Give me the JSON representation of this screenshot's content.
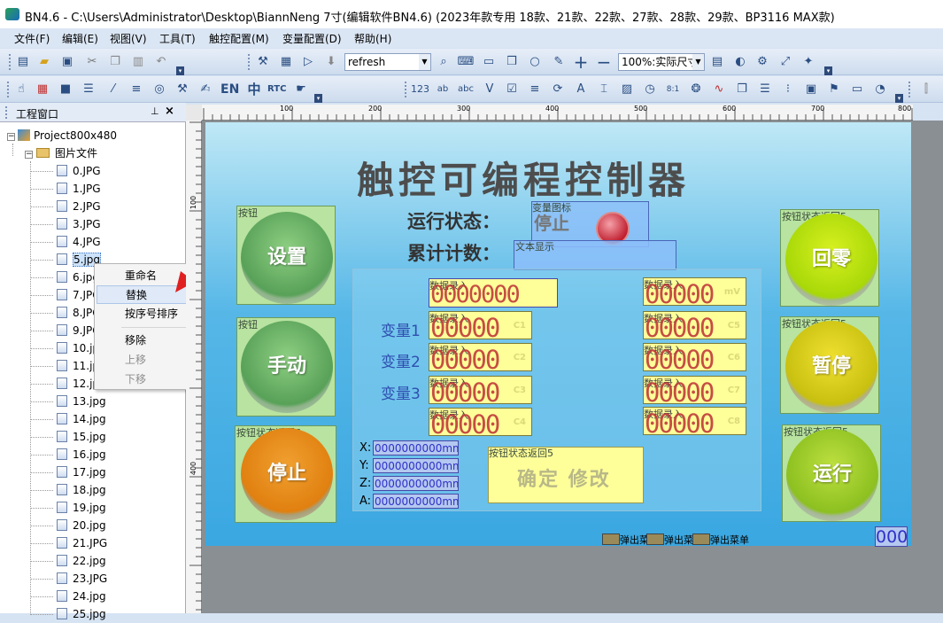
{
  "window": {
    "title": "BN4.6 - C:\\Users\\Administrator\\Desktop\\BiannNeng 7寸(编辑软件BN4.6) (2023年款专用 18款、21款、22款、27款、28款、29款、BP3116 MAX款)"
  },
  "menu": [
    "文件(F)",
    "编辑(E)",
    "视图(V)",
    "工具(T)",
    "触控配置(M)",
    "变量配置(D)",
    "帮助(H)"
  ],
  "toolbar": {
    "refresh_combo": "refresh",
    "zoom_combo": "100%:实际尺寸",
    "en_label": "EN",
    "zh_label": "中",
    "rtc_label": "RTC"
  },
  "panel": {
    "title": "工程窗口",
    "pin": "⊥",
    "close": "×"
  },
  "tree": {
    "project": "Project800x480",
    "folder": "图片文件",
    "files": [
      "0.JPG",
      "1.JPG",
      "2.JPG",
      "3.JPG",
      "4.JPG",
      "5.jpg",
      "6.jpg",
      "7.JPG",
      "8.JPG",
      "9.JPG",
      "10.jpg",
      "11.jpg",
      "12.jpg",
      "13.jpg",
      "14.jpg",
      "15.jpg",
      "16.jpg",
      "17.jpg",
      "18.jpg",
      "19.jpg",
      "20.jpg",
      "21.JPG",
      "22.jpg",
      "23.JPG",
      "24.jpg",
      "25.jpg"
    ]
  },
  "context_menu": {
    "items": [
      "重命名",
      "替换",
      "按序号排序",
      "移除",
      "上移",
      "下移"
    ]
  },
  "ruler": {
    "top": [
      "100",
      "200",
      "300",
      "400",
      "500",
      "600",
      "700",
      "800"
    ],
    "left": [
      "100",
      "400"
    ]
  },
  "hmi": {
    "title": "触控可编程控制器",
    "run_state_label": "运行状态：",
    "run_state_value": "停止",
    "count_label": "累计计数：",
    "var_icon_tag": "变量图标",
    "text_display_tag": "文本显示",
    "button_tag": "按钮",
    "button_state_tag5": "按钮状态返回5",
    "button_state_tag6": "按钮状态返回6",
    "btn_setup": "设置",
    "btn_manual": "手动",
    "btn_stop": "停止",
    "btn_zero": "回零",
    "btn_pause": "暂停",
    "btn_run": "运行",
    "var1": "变量1",
    "var2": "变量2",
    "var3": "变量3",
    "data_entry": "数据录入",
    "big_value": "0000000",
    "small_value": "00000",
    "units": [
      "mV",
      "C1",
      "C2",
      "C3",
      "C4",
      "C5",
      "C6",
      "C7",
      "C8"
    ],
    "axes": [
      {
        "label": "X:",
        "value": "0000000000mm"
      },
      {
        "label": "Y:",
        "value": "0000000000mm"
      },
      {
        "label": "Z:",
        "value": "0000000000mm"
      },
      {
        "label": "A:",
        "value": "0000000000mm"
      }
    ],
    "confirm_btn": "确定 修改",
    "popup_menu": "弹出菜单",
    "corner_num": "000"
  }
}
